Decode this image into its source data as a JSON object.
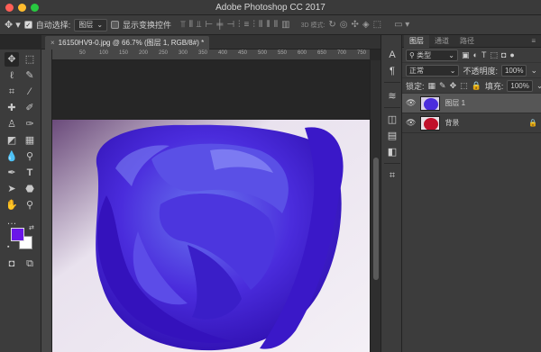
{
  "window": {
    "title": "Adobe Photoshop CC 2017"
  },
  "traffic_lights": {
    "close": "#ff5f57",
    "minimize": "#febc2e",
    "zoom": "#28c840"
  },
  "options_bar": {
    "move_tool_icon": "move-icon",
    "auto_select_label": "自动选择:",
    "auto_select_checked": true,
    "auto_select_target": "图层",
    "show_transform_label": "显示变换控件",
    "show_transform_checked": false,
    "mode_3d_label": "3D 模式:"
  },
  "document_tab": {
    "close": "×",
    "title": "16150HV9-0.jpg @ 66.7% (图层 1, RGB/8#) *"
  },
  "ruler": {
    "ticks": [
      "50",
      "100",
      "150",
      "200",
      "250",
      "300",
      "350",
      "400",
      "450",
      "500",
      "550",
      "600",
      "650",
      "700",
      "750"
    ]
  },
  "toolbox": {
    "tools": [
      "move-icon",
      "marquee-icon",
      "lasso-icon",
      "quick-select-icon",
      "crop-icon",
      "eyedropper-icon",
      "healing-icon",
      "brush-icon",
      "stamp-icon",
      "history-brush-icon",
      "eraser-icon",
      "gradient-icon",
      "blur-icon",
      "dodge-icon",
      "pen-icon",
      "type-icon",
      "path-select-icon",
      "shape-icon",
      "hand-icon",
      "zoom-icon"
    ],
    "more": "…",
    "foreground_color": "#6a16e8",
    "background_color": "#ffffff"
  },
  "layers_panel": {
    "tabs": [
      "图层",
      "通道",
      "路径"
    ],
    "filter_kind": "类型",
    "blend_mode": "正常",
    "opacity_label": "不透明度:",
    "opacity_value": "100%",
    "lock_label": "锁定:",
    "fill_label": "填充:",
    "fill_value": "100%",
    "layers": [
      {
        "name": "图层 1",
        "selected": true,
        "locked": false
      },
      {
        "name": "背景",
        "selected": false,
        "locked": true
      }
    ]
  }
}
